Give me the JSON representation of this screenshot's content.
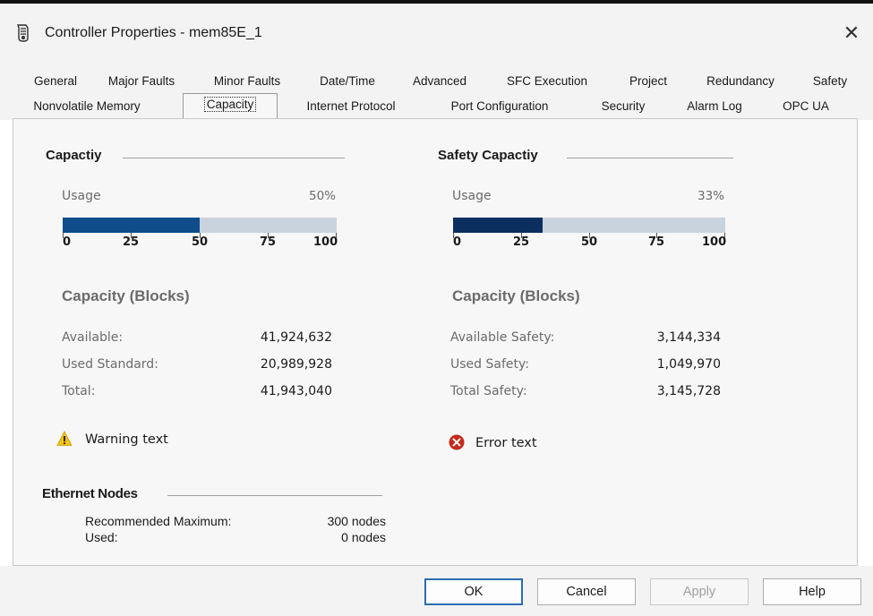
{
  "window": {
    "title": "Controller Properties - mem85E_1"
  },
  "tabs": {
    "row1": [
      "General",
      "Major Faults",
      "Minor Faults",
      "Date/Time",
      "Advanced",
      "SFC Execution",
      "Project",
      "Redundancy",
      "Safety"
    ],
    "row2": [
      "Nonvolatile Memory",
      "Capacity",
      "Internet Protocol",
      "Port Configuration",
      "Security",
      "Alarm Log",
      "OPC UA"
    ],
    "selected": "Capacity"
  },
  "capacity": {
    "title": "Capactiy",
    "usage_label": "Usage",
    "usage_percent_text": "50%",
    "usage_fraction": 0.5,
    "scale": [
      "0",
      "25",
      "50",
      "75",
      "100"
    ],
    "blocks_header": "Capacity (Blocks)",
    "rows": [
      {
        "label": "Available:",
        "value": "41,924,632"
      },
      {
        "label": "Used Standard:",
        "value": "20,989,928"
      },
      {
        "label": "Total:",
        "value": "41,943,040"
      }
    ],
    "message": "Warning text",
    "fill_color": "#0f4c8a"
  },
  "safety_capacity": {
    "title": "Safety Capactiy",
    "usage_label": "Usage",
    "usage_percent_text": "33%",
    "usage_fraction": 0.33,
    "scale": [
      "0",
      "25",
      "50",
      "75",
      "100"
    ],
    "blocks_header": "Capacity (Blocks)",
    "rows": [
      {
        "label": "Available Safety:",
        "value": "3,144,334"
      },
      {
        "label": "Used Safety:",
        "value": "1,049,970"
      },
      {
        "label": "Total Safety:",
        "value": "3,145,728"
      }
    ],
    "message": "Error text",
    "fill_color": "#0a2f5e"
  },
  "ethernet_nodes": {
    "title": "Ethernet Nodes",
    "rows": [
      {
        "label": "Recommended Maximum:",
        "value": "300 nodes"
      },
      {
        "label": "Used:",
        "value": "0 nodes"
      }
    ]
  },
  "buttons": {
    "ok": "OK",
    "cancel": "Cancel",
    "apply": "Apply",
    "help": "Help"
  },
  "colors": {
    "warning": "#f2c318",
    "error": "#c42b1c",
    "bar_track": "#c8d3de"
  },
  "icons": {
    "warning": "warning-icon",
    "error": "error-icon",
    "close": "close-icon",
    "app": "controller-icon"
  }
}
